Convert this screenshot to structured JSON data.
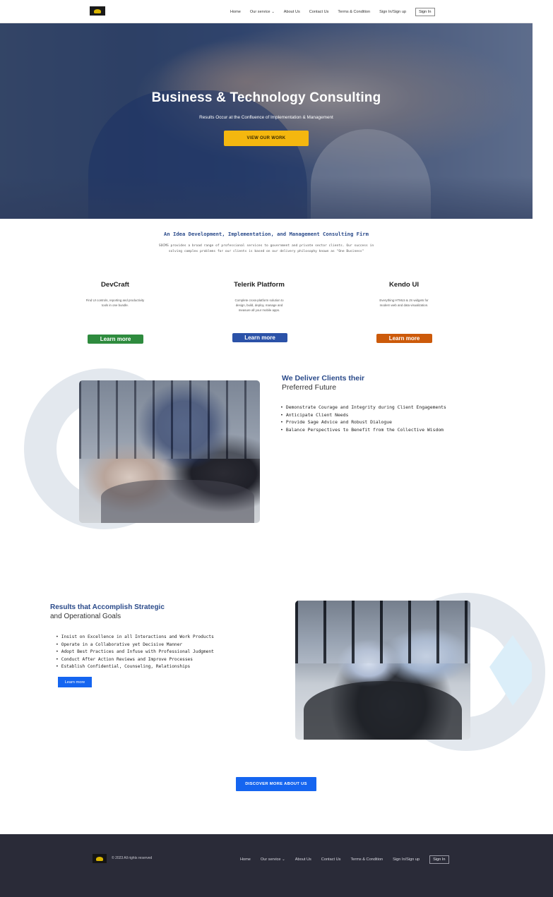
{
  "header": {
    "nav": [
      {
        "label": "Home"
      },
      {
        "label": "Our service"
      },
      {
        "label": "About Us"
      },
      {
        "label": "Contact Us"
      },
      {
        "label": "Terms & Condition"
      },
      {
        "label": "Sign In/Sign up"
      }
    ],
    "signin_label": "Sign In"
  },
  "hero": {
    "title": "Business & Technology Consulting",
    "subtitle": "Results Occur at the Confluence of Implementation & Management",
    "button_label": "VIEW OUR WORK"
  },
  "intro": {
    "heading": "An Idea Development, Implementation, and Management Consulting Firm",
    "text": "SOCMS provides a broad range of professional services to government and private sector clients. Our success in solving complex problems for our clients is based on our delivery philosophy known as \"One Business\""
  },
  "products": [
    {
      "title": "DevCraft",
      "description": "Find UI controls, reporting and productivity tools in one bundle.",
      "button": "Learn more",
      "color": "#2e8b3e"
    },
    {
      "title": "Telerik Platform",
      "description": "Complete cross-platform solution to design, build, deploy, manage and measure all your mobile apps.",
      "button": "Learn more",
      "color": "#2b52a8"
    },
    {
      "title": "Kendo UI",
      "description": "Everything HTML5 & JS widgets for modern web and data visualization.",
      "button": "Learn more",
      "color": "#cc5a0a"
    }
  ],
  "deliver": {
    "title": "We Deliver Clients their",
    "subtitle": "Preferred Future",
    "bullets": [
      "Demonstrate Courage and Integrity during Client Engagements",
      "Anticipate Client Needs",
      "Provide Sage Advice and Robust Dialogue",
      "Balance Perspectives to Benefit from the Collective Wisdom"
    ]
  },
  "results": {
    "title": "Results that Accomplish Strategic",
    "subtitle": "and Operational Goals",
    "bullets": [
      "Insist on Excellence in all Interactions and Work Products",
      "Operate in a Collaborative yet Decisive Manner",
      "Adopt Best Practices and Infuse with Professional Judgment",
      "Conduct After Action Reviews and Improve Processes",
      "Establish Confidential, Counseling, Relationships"
    ],
    "button_label": "Learn more"
  },
  "discover_label": "DISCOVER MORE ABOUT US",
  "footer": {
    "copyright": "© 2023 All rights reserved",
    "nav": [
      {
        "label": "Home"
      },
      {
        "label": "Our service"
      },
      {
        "label": "About Us"
      },
      {
        "label": "Contact Us"
      },
      {
        "label": "Terms & Condition"
      },
      {
        "label": "Sign In/Sign up"
      }
    ],
    "signin_label": "Sign In"
  },
  "colors": {
    "accent": "#f4b70f",
    "primary_blue": "#1565f0",
    "heading_blue": "#2a4a8a",
    "footer_bg": "#2a2b38"
  }
}
